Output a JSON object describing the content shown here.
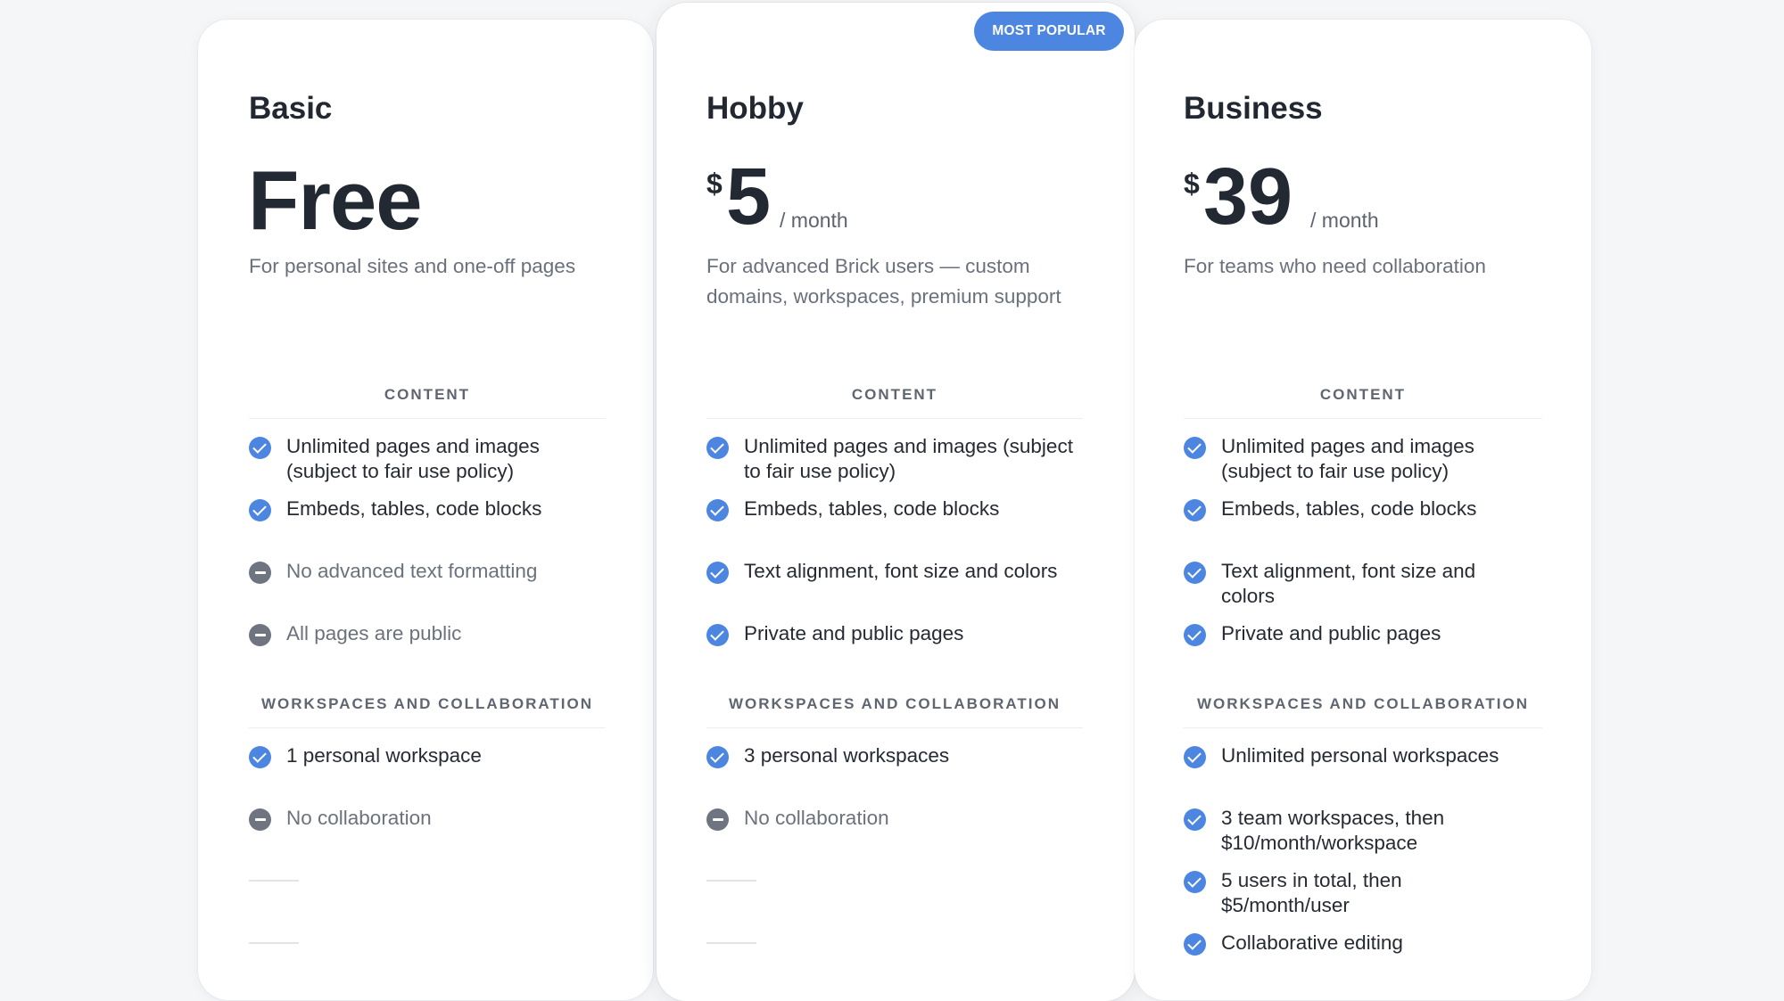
{
  "badge": "MOST POPULAR",
  "plans": [
    {
      "name": "Basic",
      "price": "Free",
      "description": "For personal sites and one-off pages",
      "sections": [
        {
          "title": "CONTENT",
          "features": [
            {
              "text": "Unlimited pages and images (subject to fair use policy)",
              "included": true
            },
            {
              "text": "Embeds, tables, code blocks",
              "included": true
            },
            {
              "text": "No advanced text formatting",
              "included": false
            },
            {
              "text": "All pages are public",
              "included": false
            }
          ]
        },
        {
          "title": "WORKSPACES AND COLLABORATION",
          "features": [
            {
              "text": "1 personal workspace",
              "included": true
            },
            {
              "text": "No collaboration",
              "included": false
            }
          ]
        }
      ]
    },
    {
      "name": "Hobby",
      "currency": "$",
      "amount": "5",
      "period": "/ month",
      "description": "For advanced Brick users — custom domains, workspaces, premium support",
      "sections": [
        {
          "title": "CONTENT",
          "features": [
            {
              "text": "Unlimited pages and images (subject to fair use policy)",
              "included": true
            },
            {
              "text": "Embeds, tables, code blocks",
              "included": true
            },
            {
              "text": "Text alignment, font size and colors",
              "included": true
            },
            {
              "text": "Private and public pages",
              "included": true
            }
          ]
        },
        {
          "title": "WORKSPACES AND COLLABORATION",
          "features": [
            {
              "text": "3 personal workspaces",
              "included": true
            },
            {
              "text": "No collaboration",
              "included": false
            }
          ]
        }
      ]
    },
    {
      "name": "Business",
      "currency": "$",
      "amount": "39",
      "period": "/ month",
      "description": "For teams who need collaboration",
      "sections": [
        {
          "title": "CONTENT",
          "features": [
            {
              "text": "Unlimited pages and images (subject to fair use policy)",
              "included": true
            },
            {
              "text": "Embeds, tables, code blocks",
              "included": true
            },
            {
              "text": "Text alignment, font size and colors",
              "included": true
            },
            {
              "text": "Private and public pages",
              "included": true
            }
          ]
        },
        {
          "title": "WORKSPACES AND COLLABORATION",
          "features": [
            {
              "text": "Unlimited personal workspaces",
              "included": true
            },
            {
              "text": "3 team workspaces, then $10/month/workspace",
              "included": true
            },
            {
              "text": "5 users in total, then $5/month/user",
              "included": true
            },
            {
              "text": "Collaborative editing",
              "included": true
            }
          ]
        }
      ]
    }
  ],
  "colors": {
    "accent": "#4c86e1",
    "excluded": "#6f7580",
    "background": "#f5f6f8"
  }
}
